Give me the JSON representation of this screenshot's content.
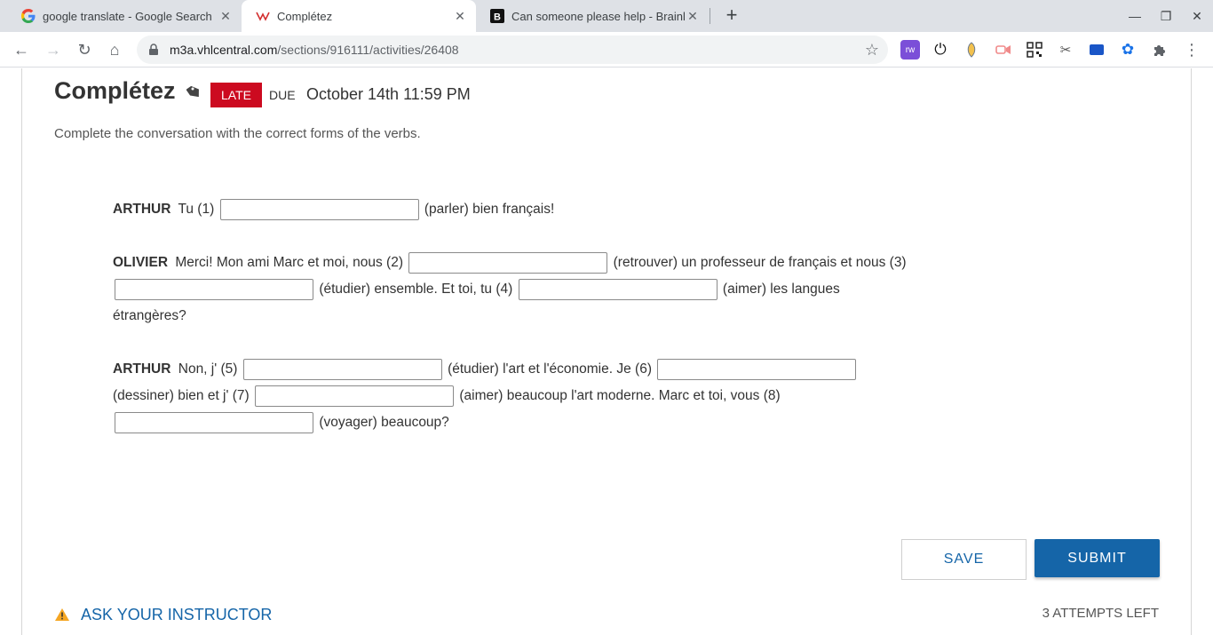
{
  "browser": {
    "tabs": [
      {
        "title": "google translate - Google Search",
        "icon": "google-g-icon"
      },
      {
        "title": "Complétez",
        "icon": "vhl-icon"
      },
      {
        "title": "Can someone please help - Brainly",
        "icon": "brainly-icon"
      }
    ],
    "url_host": "m3a.vhlcentral.com",
    "url_path": "/sections/916111/activities/26408"
  },
  "activity": {
    "title": "Complétez",
    "late_badge": "LATE",
    "due_label": "DUE",
    "due_date": "October 14th 11:59 PM",
    "instructions": "Complete the conversation with the correct forms of the verbs."
  },
  "dialogue": {
    "p1": {
      "speaker": "ARTHUR",
      "t1": "Tu (1)",
      "t2": "(parler) bien français!"
    },
    "p2": {
      "speaker": "OLIVIER",
      "t1": "Merci! Mon ami Marc et moi, nous (2)",
      "t2": "(retrouver) un professeur de français et nous (3)",
      "t3": "(étudier) ensemble. Et toi, tu (4)",
      "t4": "(aimer) les langues étrangères?"
    },
    "p3": {
      "speaker": "ARTHUR",
      "t1": "Non, j' (5)",
      "t2": "(étudier) l'art et l'économie. Je (6)",
      "t3": "(dessiner) bien et j' (7)",
      "t4": "(aimer) beaucoup l'art moderne. Marc et toi, vous (8)",
      "t5": "(voyager) beaucoup?"
    },
    "answers": [
      "",
      "",
      "",
      "",
      "",
      "",
      "",
      ""
    ]
  },
  "actions": {
    "save_label": "SAVE",
    "submit_label": "SUBMIT",
    "ask_label": "ASK YOUR INSTRUCTOR",
    "attempts_text": "3 ATTEMPTS LEFT"
  },
  "colors": {
    "accent": "#1565a8",
    "late": "#cc0a20",
    "warning": "#f5a623"
  }
}
